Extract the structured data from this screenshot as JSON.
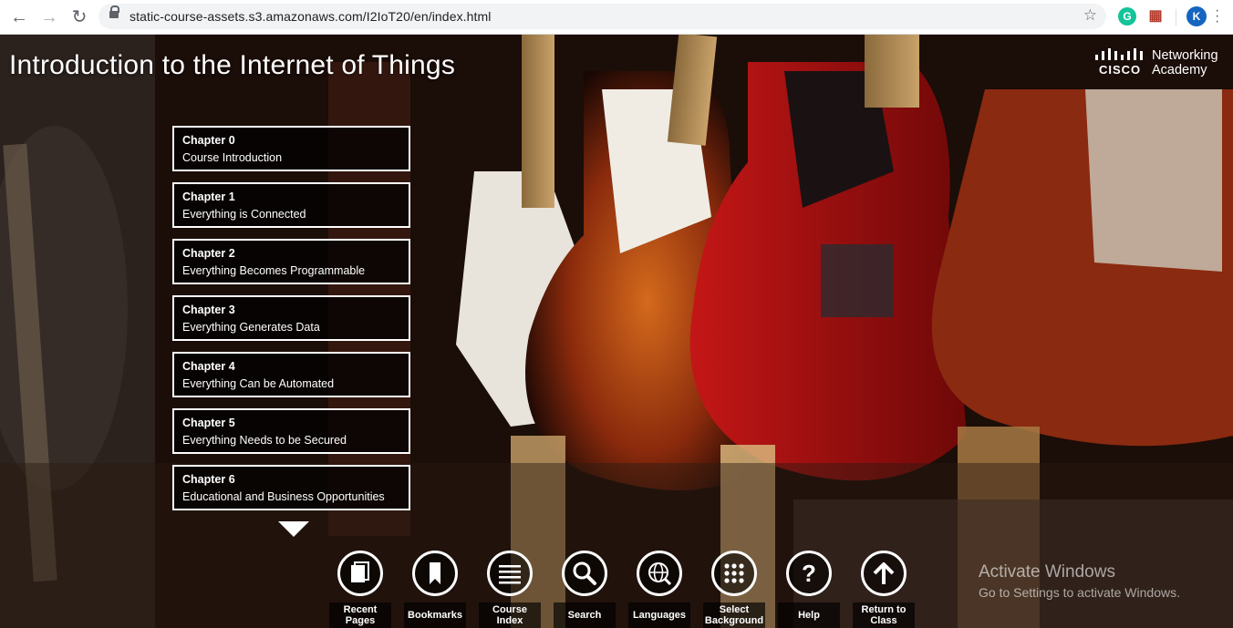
{
  "browser": {
    "url": "static-course-assets.s3.amazonaws.com/I2IoT20/en/index.html",
    "profile_initial": "K",
    "grammarly_initial": "G"
  },
  "page": {
    "title": "Introduction to the Internet of Things",
    "brand": {
      "word": "CISCO",
      "line1": "Networking",
      "line2": "Academy"
    }
  },
  "chapters": [
    {
      "number": "Chapter 0",
      "title": "Course Introduction"
    },
    {
      "number": "Chapter 1",
      "title": "Everything is Connected"
    },
    {
      "number": "Chapter 2",
      "title": "Everything Becomes Programmable"
    },
    {
      "number": "Chapter 3",
      "title": "Everything Generates Data"
    },
    {
      "number": "Chapter 4",
      "title": "Everything Can be Automated"
    },
    {
      "number": "Chapter 5",
      "title": "Everything Needs to be Secured"
    },
    {
      "number": "Chapter 6",
      "title": "Educational and Business Opportunities"
    }
  ],
  "toolbar": [
    {
      "label": "Recent Pages",
      "icon": "recent-pages-icon"
    },
    {
      "label": "Bookmarks",
      "icon": "bookmark-icon"
    },
    {
      "label": "Course Index",
      "icon": "list-icon"
    },
    {
      "label": "Search",
      "icon": "search-icon"
    },
    {
      "label": "Languages",
      "icon": "globe-icon"
    },
    {
      "label": "Select Background",
      "icon": "grid-dots-icon"
    },
    {
      "label": "Help",
      "icon": "help-icon"
    },
    {
      "label": "Return to Class",
      "icon": "arrow-up-icon"
    }
  ],
  "watermark": {
    "line1": "Activate Windows",
    "line2": "Go to Settings to activate Windows."
  }
}
